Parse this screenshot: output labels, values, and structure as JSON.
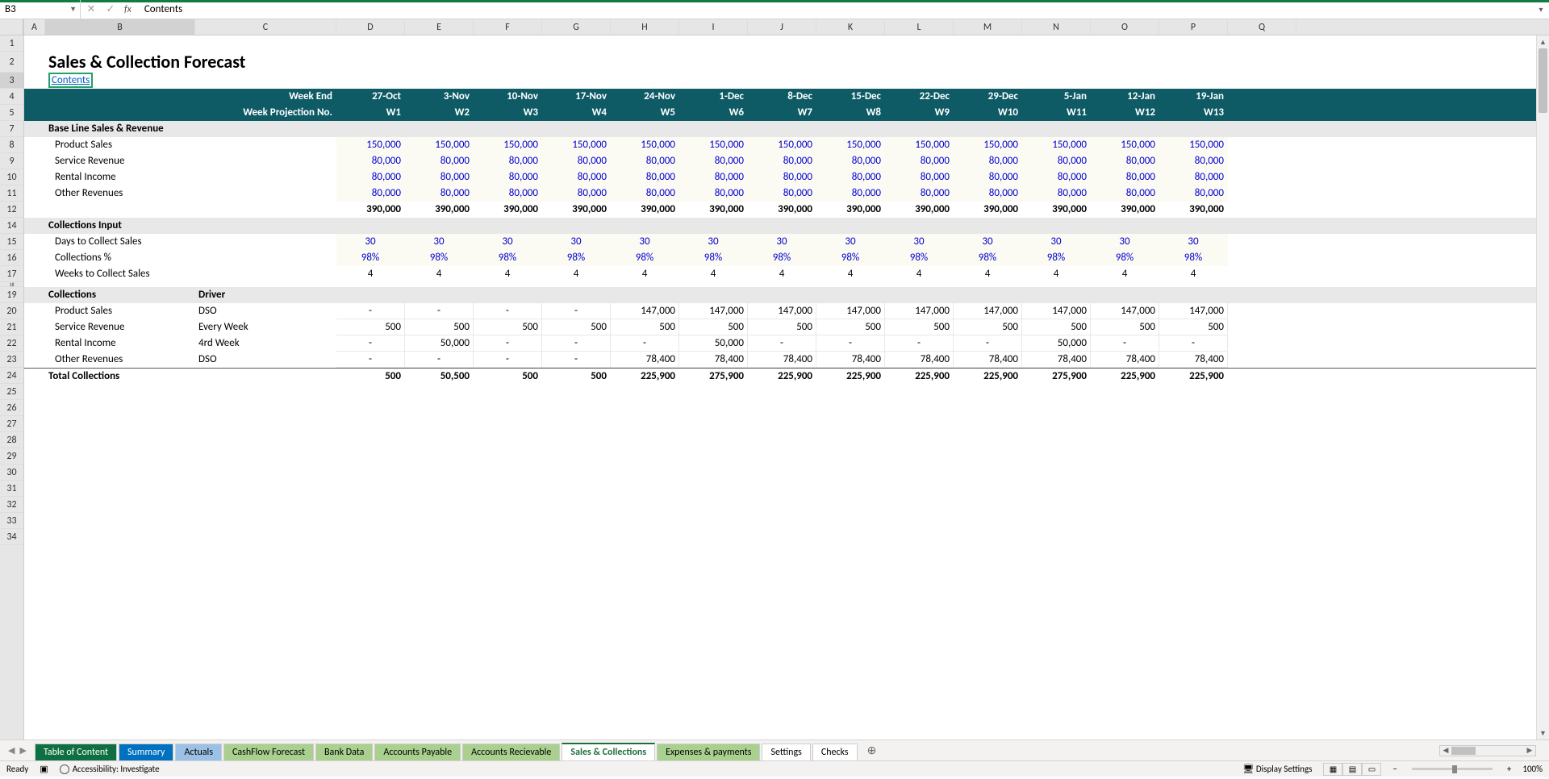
{
  "formula_bar": {
    "name_box": "B3",
    "value": "Contents"
  },
  "columns": [
    "A",
    "B",
    "C",
    "D",
    "E",
    "F",
    "G",
    "H",
    "I",
    "J",
    "K",
    "L",
    "M",
    "N",
    "O",
    "P",
    "Q"
  ],
  "row_numbers": [
    1,
    2,
    3,
    4,
    5,
    7,
    8,
    9,
    10,
    11,
    12,
    14,
    15,
    16,
    17,
    19,
    20,
    21,
    22,
    23,
    24,
    25,
    26,
    27,
    28,
    29,
    30,
    31,
    32,
    33,
    34
  ],
  "title": "Sales & Collection Forecast",
  "contents_link": "Contents",
  "header": {
    "week_end_label": "Week End",
    "week_proj_label": "Week Projection No.",
    "dates": [
      "27-Oct",
      "3-Nov",
      "10-Nov",
      "17-Nov",
      "24-Nov",
      "1-Dec",
      "8-Dec",
      "15-Dec",
      "22-Dec",
      "29-Dec",
      "5-Jan",
      "12-Jan",
      "19-Jan"
    ],
    "weeks": [
      "W1",
      "W2",
      "W3",
      "W4",
      "W5",
      "W6",
      "W7",
      "W8",
      "W9",
      "W10",
      "W11",
      "W12",
      "W13"
    ]
  },
  "baseline": {
    "label": "Base Line Sales & Revenue",
    "rows": [
      {
        "label": "Product Sales",
        "vals": [
          "150,000",
          "150,000",
          "150,000",
          "150,000",
          "150,000",
          "150,000",
          "150,000",
          "150,000",
          "150,000",
          "150,000",
          "150,000",
          "150,000",
          "150,000"
        ]
      },
      {
        "label": "Service Revenue",
        "vals": [
          "80,000",
          "80,000",
          "80,000",
          "80,000",
          "80,000",
          "80,000",
          "80,000",
          "80,000",
          "80,000",
          "80,000",
          "80,000",
          "80,000",
          "80,000"
        ]
      },
      {
        "label": "Rental Income",
        "vals": [
          "80,000",
          "80,000",
          "80,000",
          "80,000",
          "80,000",
          "80,000",
          "80,000",
          "80,000",
          "80,000",
          "80,000",
          "80,000",
          "80,000",
          "80,000"
        ]
      },
      {
        "label": "Other Revenues",
        "vals": [
          "80,000",
          "80,000",
          "80,000",
          "80,000",
          "80,000",
          "80,000",
          "80,000",
          "80,000",
          "80,000",
          "80,000",
          "80,000",
          "80,000",
          "80,000"
        ]
      }
    ],
    "total": [
      "390,000",
      "390,000",
      "390,000",
      "390,000",
      "390,000",
      "390,000",
      "390,000",
      "390,000",
      "390,000",
      "390,000",
      "390,000",
      "390,000",
      "390,000"
    ]
  },
  "coll_input": {
    "label": "Collections Input",
    "rows": [
      {
        "label": "Days to Collect Sales",
        "vals": [
          "30",
          "30",
          "30",
          "30",
          "30",
          "30",
          "30",
          "30",
          "30",
          "30",
          "30",
          "30",
          "30"
        ],
        "blue": true
      },
      {
        "label": "Collections %",
        "vals": [
          "98%",
          "98%",
          "98%",
          "98%",
          "98%",
          "98%",
          "98%",
          "98%",
          "98%",
          "98%",
          "98%",
          "98%",
          "98%"
        ],
        "blue": true
      },
      {
        "label": "Weeks to Collect Sales",
        "vals": [
          "4",
          "4",
          "4",
          "4",
          "4",
          "4",
          "4",
          "4",
          "4",
          "4",
          "4",
          "4",
          "4"
        ],
        "blue": false
      }
    ]
  },
  "collections": {
    "label": "Collections",
    "driver_label": "Driver",
    "rows": [
      {
        "label": "Product Sales",
        "driver": "DSO",
        "vals": [
          "-",
          "-",
          "-",
          "-",
          "147,000",
          "147,000",
          "147,000",
          "147,000",
          "147,000",
          "147,000",
          "147,000",
          "147,000",
          "147,000"
        ]
      },
      {
        "label": "Service Revenue",
        "driver": "Every Week",
        "vals": [
          "500",
          "500",
          "500",
          "500",
          "500",
          "500",
          "500",
          "500",
          "500",
          "500",
          "500",
          "500",
          "500"
        ]
      },
      {
        "label": "Rental Income",
        "driver": "4rd Week",
        "vals": [
          "-",
          "50,000",
          "-",
          "-",
          "-",
          "50,000",
          "-",
          "-",
          "-",
          "-",
          "50,000",
          "-",
          "-"
        ]
      },
      {
        "label": "Other Revenues",
        "driver": "DSO",
        "vals": [
          "-",
          "-",
          "-",
          "-",
          "78,400",
          "78,400",
          "78,400",
          "78,400",
          "78,400",
          "78,400",
          "78,400",
          "78,400",
          "78,400"
        ]
      }
    ],
    "total_label": "Total Collections",
    "total": [
      "500",
      "50,500",
      "500",
      "500",
      "225,900",
      "275,900",
      "225,900",
      "225,900",
      "225,900",
      "225,900",
      "275,900",
      "225,900",
      "225,900"
    ]
  },
  "sheets": [
    {
      "name": "Table of Content",
      "cls": "green-dark"
    },
    {
      "name": "Summary",
      "cls": "blue"
    },
    {
      "name": "Actuals",
      "cls": "blue-light"
    },
    {
      "name": "CashFlow Forecast",
      "cls": "green"
    },
    {
      "name": "Bank Data",
      "cls": "green"
    },
    {
      "name": "Accounts Payable",
      "cls": "green"
    },
    {
      "name": "Accounts Recievable",
      "cls": "green"
    },
    {
      "name": "Sales & Collections",
      "cls": "active"
    },
    {
      "name": "Expenses & payments",
      "cls": "green"
    },
    {
      "name": "Settings",
      "cls": ""
    },
    {
      "name": "Checks",
      "cls": ""
    }
  ],
  "status": {
    "ready": "Ready",
    "accessibility": "Accessibility: Investigate",
    "display_settings": "Display Settings",
    "zoom": "100%"
  },
  "row18_num": "18"
}
